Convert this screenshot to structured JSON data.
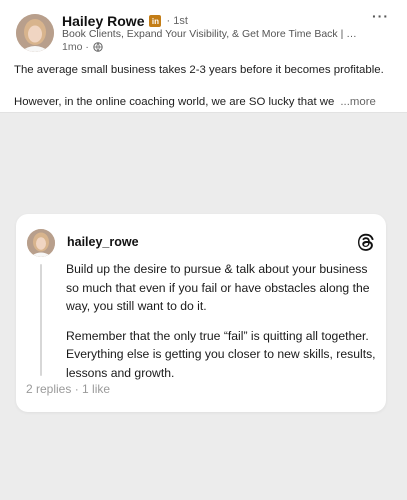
{
  "post": {
    "author_name": "Hailey Rowe",
    "badge": "in",
    "degree": "· 1st",
    "headline": "Book Clients, Expand Your Visibility, & Get More Time Back | Bus...",
    "time": "1mo ·",
    "more_label": "···",
    "text_1": "The average small business takes 2-3 years before it becomes profitable.",
    "text_2": "However, in the online coaching world, we are SO lucky that we",
    "see_more": "...more"
  },
  "thread": {
    "username": "hailey_rowe",
    "paragraph_1": "Build up the desire to pursue & talk about your business so much that even if you fail or have obstacles along the way, you still want to do it.",
    "paragraph_2": "Remember that the only true “fail” is quitting all together. Everything else is getting you closer to new skills, results, lessons and growth.",
    "stats": "2 replies · 1 like"
  }
}
